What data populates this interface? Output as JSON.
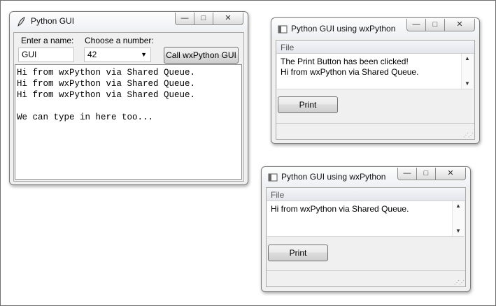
{
  "tk_window": {
    "title": "Python GUI",
    "name_label": "Enter a name:",
    "name_value": "GUI",
    "number_label": "Choose a number:",
    "number_value": "42",
    "call_button": "Call wxPython GUI",
    "text_lines": [
      "Hi from wxPython via Shared Queue.",
      "Hi from wxPython via Shared Queue.",
      "Hi from wxPython via Shared Queue.",
      "",
      "We can type in here too..."
    ]
  },
  "wx_window_1": {
    "title": "Python GUI using wxPython",
    "menu_file": "File",
    "lines": [
      "The Print Button has been clicked!",
      "Hi from wxPython via Shared Queue."
    ],
    "print_button": "Print"
  },
  "wx_window_2": {
    "title": "Python GUI using wxPython",
    "menu_file": "File",
    "lines": [
      "Hi from wxPython via Shared Queue."
    ],
    "print_button": "Print"
  },
  "caption_buttons": {
    "minimize": "—",
    "maximize": "□",
    "close": "✕"
  }
}
